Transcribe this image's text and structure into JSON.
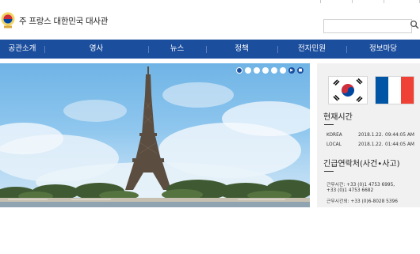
{
  "header": {
    "site_title": "주 프랑스 대한민국 대사관",
    "search_placeholder": ""
  },
  "nav": {
    "items": [
      "공관소개",
      "영사",
      "뉴스",
      "정책",
      "전자민원",
      "정보마당"
    ]
  },
  "banner": {
    "subject": "Eiffel Tower photo",
    "slides_total": 6,
    "active_slide": 1
  },
  "time": {
    "title": "현재시간",
    "rows": [
      {
        "label": "KOREA",
        "date": "2018.1.22.",
        "time": "09:44:05 AM"
      },
      {
        "label": "LOCAL",
        "date": "2018.1.22.",
        "time": "01:44:05 AM"
      }
    ]
  },
  "emergency": {
    "title": "긴급연락처(사건•사고)",
    "lines": [
      "근무시간: +33 (0)1 4753 6995,",
      "+33 (0)1 4753 6682",
      "근무시간외: +33 (0)6-8028 5396"
    ]
  },
  "colors": {
    "nav_bg": "#1c4e9e",
    "sidebar_bg": "#f1f1f1"
  }
}
